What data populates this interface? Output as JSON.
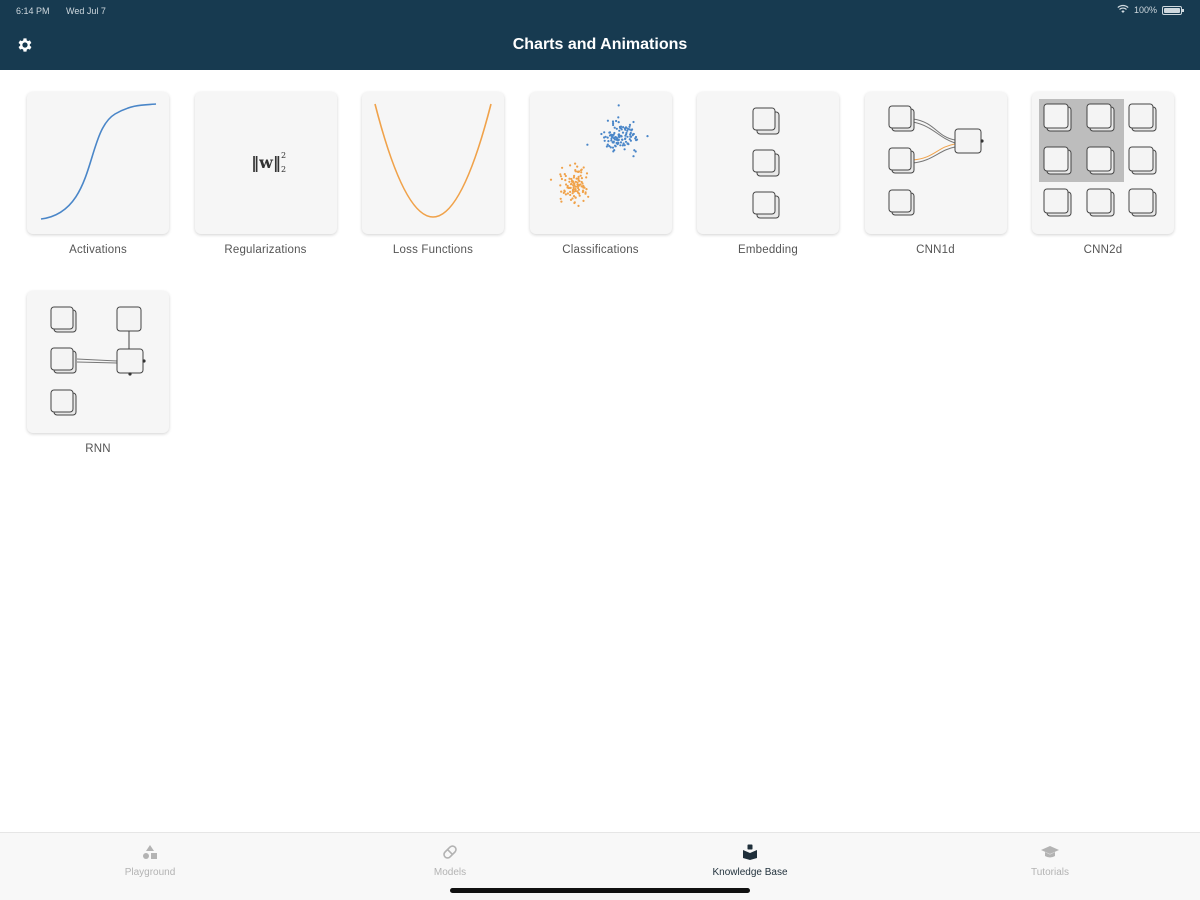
{
  "status_bar": {
    "time": "6:14 PM",
    "date": "Wed Jul 7",
    "battery": "100%"
  },
  "header": {
    "title": "Charts and Animations",
    "settings_icon": "gear-icon"
  },
  "tiles": [
    {
      "label": "Activations",
      "icon": "sigmoid-curve"
    },
    {
      "label": "Regularizations",
      "icon": "norm-formula",
      "formula": "‖w‖"
    },
    {
      "label": "Loss Functions",
      "icon": "parabola-curve"
    },
    {
      "label": "Classifications",
      "icon": "scatter-clusters"
    },
    {
      "label": "Embedding",
      "icon": "stacked-boxes"
    },
    {
      "label": "CNN1d",
      "icon": "cnn1d-diagram"
    },
    {
      "label": "CNN2d",
      "icon": "cnn2d-grid"
    },
    {
      "label": "RNN",
      "icon": "rnn-diagram"
    }
  ],
  "tab_bar": {
    "tabs": [
      {
        "label": "Playground",
        "icon": "shapes-icon",
        "active": false
      },
      {
        "label": "Models",
        "icon": "pill-icon",
        "active": false
      },
      {
        "label": "Knowledge Base",
        "icon": "book-icon",
        "active": true
      },
      {
        "label": "Tutorials",
        "icon": "graduation-cap-icon",
        "active": false
      }
    ]
  },
  "colors": {
    "header_bg": "#173a50",
    "blue_series": "#4a86c8",
    "orange_series": "#f0a24a"
  }
}
